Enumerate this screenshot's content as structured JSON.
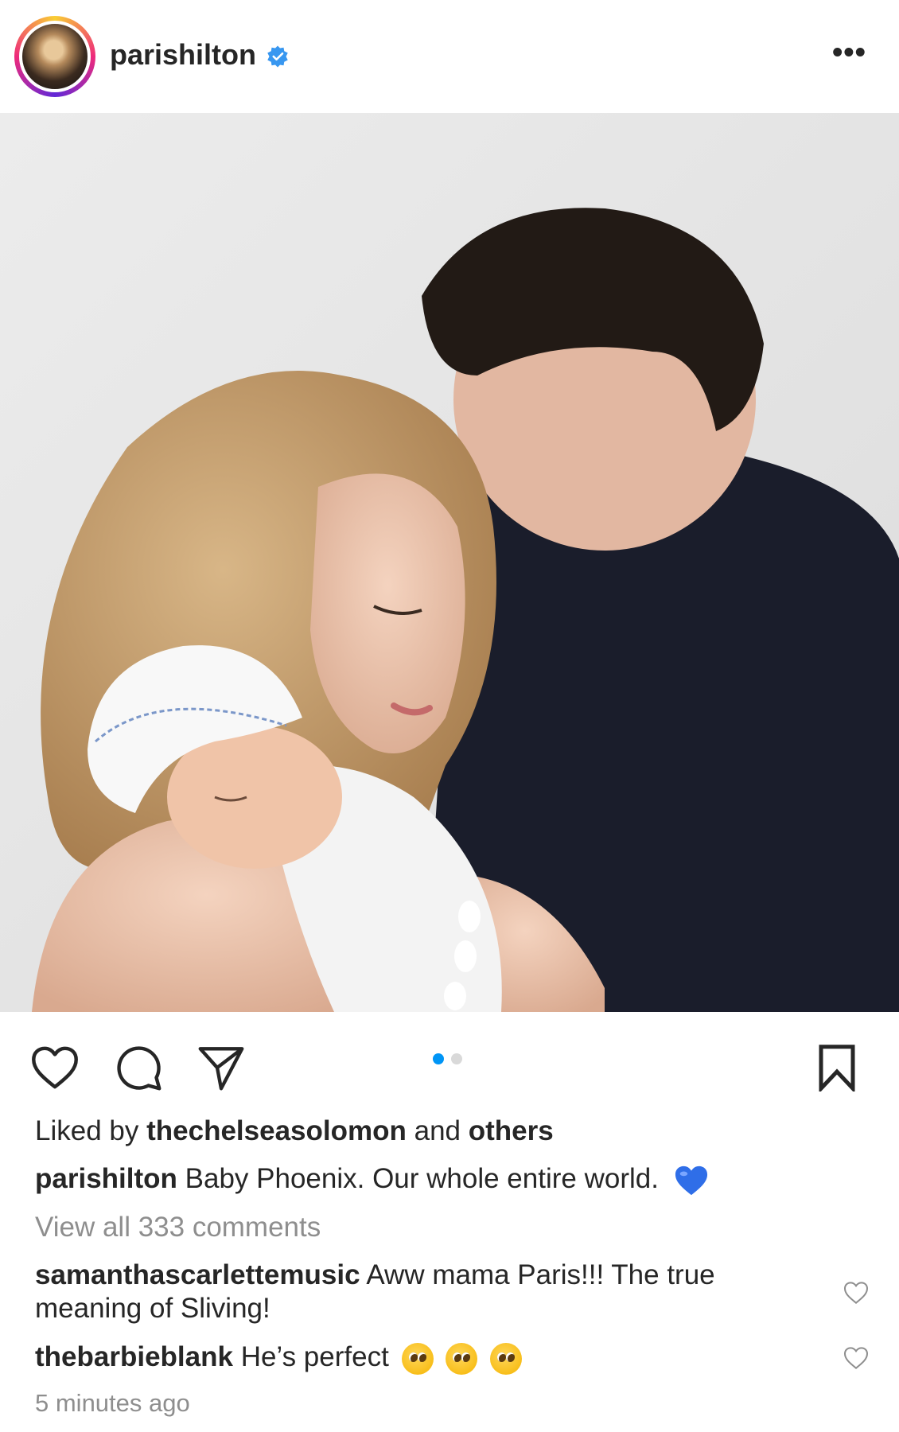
{
  "post": {
    "username": "parishilton",
    "verified": true,
    "more_label": "•••",
    "photo_alt": "Baby Phoenix photo",
    "carousel": {
      "count": 2,
      "active_index": 0
    },
    "likes": {
      "prefix": "Liked by",
      "user": "thechelseasolomon",
      "joiner": "and",
      "others": "others"
    },
    "caption": {
      "username": "parishilton",
      "text": "Baby Phoenix. Our whole entire world.",
      "emoji": "💙"
    },
    "view_comments": "View all 333 comments",
    "comments": [
      {
        "username": "samanthascarlettemusic",
        "text_line1": "Aww mama Paris!!! The true",
        "text_line2": "meaning of Sliving!"
      },
      {
        "username": "thebarbieblank",
        "text": "He’s perfect",
        "emojis": [
          "🥹",
          "🥹",
          "🥹"
        ]
      }
    ],
    "timestamp": "5 minutes ago"
  },
  "colors": {
    "accent_blue": "#0095f6",
    "verified_blue": "#3897f0",
    "text": "#262626",
    "muted": "#8e8e8e",
    "dot_inactive": "#d9d9d9"
  }
}
